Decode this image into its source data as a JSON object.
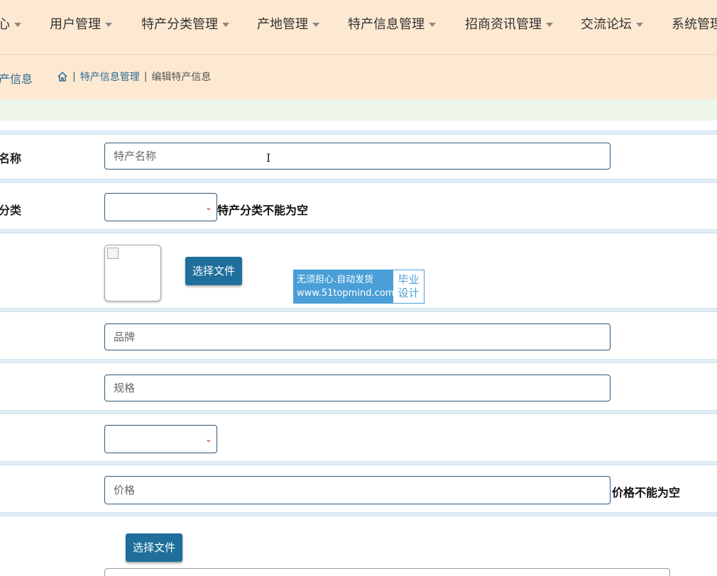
{
  "nav": {
    "items": [
      {
        "label": "心"
      },
      {
        "label": "用户管理"
      },
      {
        "label": "特产分类管理"
      },
      {
        "label": "产地管理"
      },
      {
        "label": "特产信息管理"
      },
      {
        "label": "招商资讯管理"
      },
      {
        "label": "交流论坛"
      },
      {
        "label": "系统管理"
      }
    ]
  },
  "breadcrumb": {
    "page_title": "产信息",
    "items": [
      "特产信息管理",
      "编辑特产信息"
    ],
    "separator": "|"
  },
  "form": {
    "name_label": "名称",
    "name_placeholder": "特产名称",
    "category_label": "分类",
    "category_error": "特产分类不能为空",
    "upload_button": "选择文件",
    "brand_placeholder": "品牌",
    "spec_placeholder": "规格",
    "price_placeholder": "价格",
    "price_error": "价格不能为空",
    "upload_button_2": "选择文件"
  },
  "watermark": {
    "line1": "无须担心.自动发货",
    "line2": "www.51topmind.com",
    "right1": "毕业",
    "right2": "设计"
  },
  "colors": {
    "nav_bg": "#fde9d2",
    "accent": "#1f6f9c",
    "link": "#2b6b8f",
    "watermark": "#4a9fd8"
  }
}
